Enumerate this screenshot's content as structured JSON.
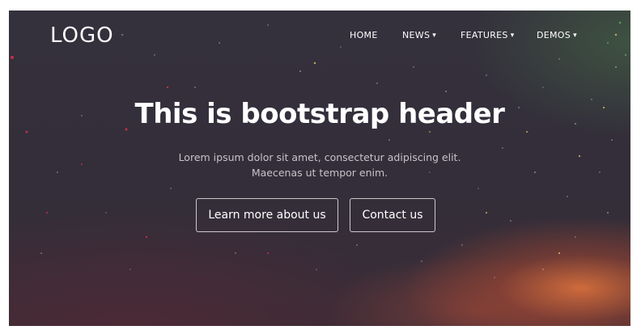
{
  "header": {
    "logo": "LOGO",
    "nav": [
      {
        "label": "HOME",
        "dropdown": false
      },
      {
        "label": "NEWS",
        "dropdown": true
      },
      {
        "label": "FEATURES",
        "dropdown": true
      },
      {
        "label": "DEMOS",
        "dropdown": true
      }
    ],
    "dropdown_caret": "▾"
  },
  "hero": {
    "title": "This is bootstrap header",
    "subtitle_line1": "Lorem ipsum dolor sit amet, consectetur adipiscing elit.",
    "subtitle_line2": "Maecenas ut tempor enim.",
    "primary_button": "Learn more about us",
    "secondary_button": "Contact us"
  },
  "colors": {
    "background": "#332e3a",
    "glow": "#d66e3c",
    "text": "#ffffff",
    "subtext": "#c9c2c8"
  }
}
